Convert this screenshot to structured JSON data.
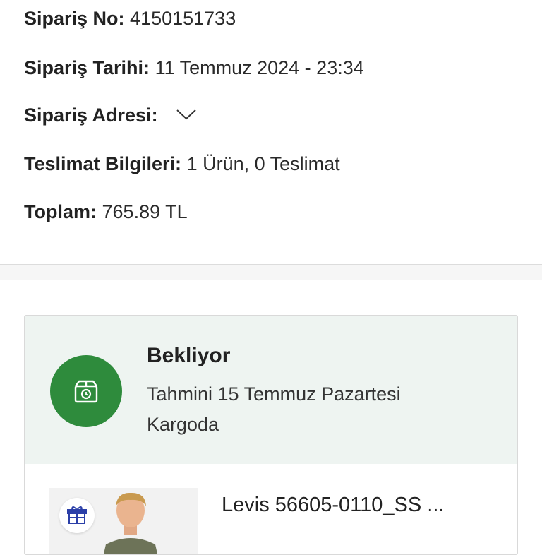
{
  "order": {
    "number_label": "Sipariş No:",
    "number_value": "4150151733",
    "date_label": "Sipariş Tarihi:",
    "date_value": "11 Temmuz 2024 - 23:34",
    "address_label": "Sipariş Adresi:",
    "delivery_label": "Teslimat Bilgileri:",
    "delivery_value": "1 Ürün, 0 Teslimat",
    "total_label": "Toplam:",
    "total_value": "765.89 TL"
  },
  "shipment": {
    "status": "Bekliyor",
    "estimate": "Tahmini 15 Temmuz Pazartesi",
    "sub_status": "Kargoda",
    "status_color": "#2e8b3c",
    "panel_color": "#eef4f1",
    "status_icon": "package-clock-icon"
  },
  "product": {
    "name": "Levis 56605-0110_SS ...",
    "badge_icon": "gift-icon",
    "badge_color": "#2b3fa8"
  }
}
